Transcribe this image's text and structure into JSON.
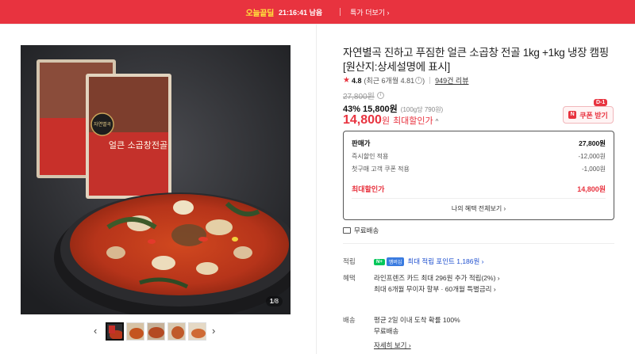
{
  "topbar": {
    "today_label": "오늘끝딜",
    "timer": "21:16:41 남음",
    "more_label": "특가 더보기 ›"
  },
  "gallery": {
    "counter_current": "1",
    "counter_total": "/8",
    "package_brand": "자연별곡",
    "package_name": "얼큰 소곱창전골"
  },
  "product": {
    "title": "자연별곡 진하고 푸짐한 얼큰 소곱창 전골 1kg +1kg 냉장 캠핑 [원산지:상세설명에 표시]",
    "rating": "4.8",
    "rating_recent": "(최근 6개월 4.81",
    "review_link": "949건 리뷰",
    "original_price": "27,800원",
    "discount_rate": "43%",
    "sale_price": "15,800원",
    "unit_price": "(100g당 790원)",
    "max_price": "14,800",
    "max_price_won": "원",
    "max_label": "최대할인가",
    "coupon_badge": "D-1",
    "coupon_label": "쿠폰 받기"
  },
  "pricebox": {
    "rows": [
      {
        "label": "판매가",
        "value": "27,800원"
      },
      {
        "label": "즉시할인 적용",
        "value": "-12,000원"
      },
      {
        "label": "첫구매 고객 쿠폰 적용",
        "value": "-1,000원"
      },
      {
        "label": "최대할인가",
        "value": "14,800원"
      }
    ],
    "all_benefits": "나의 혜택 전체보기 ›"
  },
  "shipping": {
    "free": "무료배송"
  },
  "benefits": {
    "points_label": "적립",
    "npay_badge": "N+",
    "membership_badge": "멤버십",
    "points_value": "최대 적립 포인트 1,186원 ›",
    "benefit_label": "혜택",
    "card_line": "라인프렌즈 카드 최대 296원 추가 적립(2%) ›",
    "installment_line": "최대 6개월 무이자 할부 · 60개월 특별금리 ›",
    "delivery_label": "배송",
    "delivery_line1": "평균 2일 이내 도착 확률 100%",
    "delivery_line2": "무료배송",
    "details_link": "자세히 보기 ›"
  }
}
